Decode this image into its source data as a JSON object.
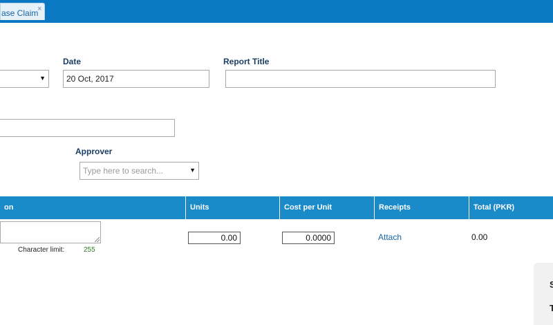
{
  "tabs": [
    {
      "label": "ase Claim",
      "close": "×"
    }
  ],
  "form": {
    "date_label": "Date",
    "date_value": "20 Oct, 2017",
    "report_title_label": "Report Title",
    "report_title_value": "",
    "approver_label": "Approver",
    "approver_placeholder": "Type here to search..."
  },
  "table": {
    "headers": [
      "on",
      "Units",
      "Cost per Unit",
      "Receipts",
      "Total (PKR)"
    ],
    "row": {
      "units": "0.00",
      "cost_per_unit": "0.0000",
      "receipts_link": "Attach",
      "total": "0.00"
    },
    "char_limit_label": "Character limit:",
    "char_limit_value": "255"
  },
  "summary": {
    "line1_initial": "S",
    "line2_initial": "T"
  },
  "colors": {
    "tabbar": "#0a78c2",
    "table_header": "#1a8ac8",
    "label": "#1b3d63",
    "link": "#1565a8",
    "char_limit_value": "#2e7d1f"
  }
}
